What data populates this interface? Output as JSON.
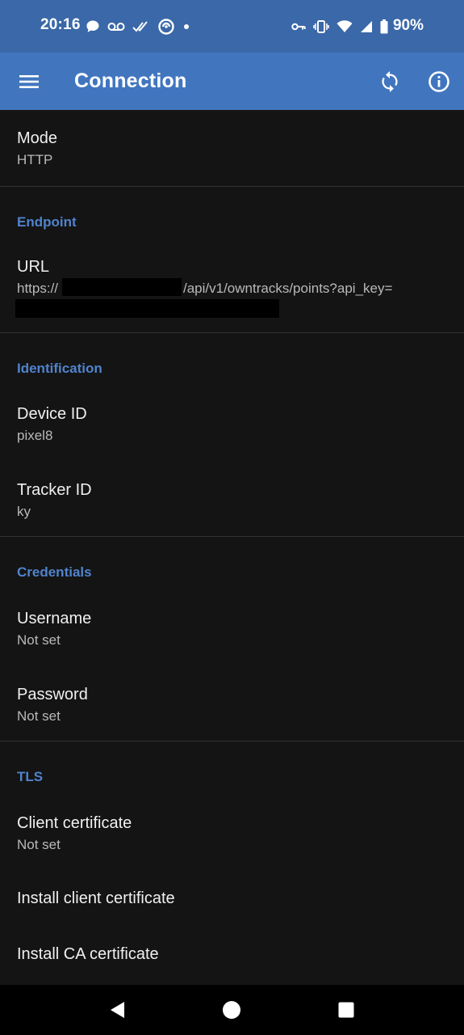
{
  "status_bar": {
    "time": "20:16",
    "battery": "90%"
  },
  "app_bar": {
    "title": "Connection",
    "icons": [
      "menu-icon",
      "sync-icon",
      "info-icon"
    ]
  },
  "preferences": {
    "mode": {
      "title": "Mode",
      "value": "HTTP"
    },
    "endpoint": {
      "category": "Endpoint",
      "url": {
        "title": "URL",
        "prefix": "https://",
        "suffix": "/api/v1/owntracks/points?api_key="
      }
    },
    "identification": {
      "category": "Identification",
      "device_id": {
        "title": "Device ID",
        "value": "pixel8"
      },
      "tracker_id": {
        "title": "Tracker ID",
        "value": "ky"
      }
    },
    "credentials": {
      "category": "Credentials",
      "username": {
        "title": "Username",
        "value": "Not set"
      },
      "password": {
        "title": "Password",
        "value": "Not set"
      }
    },
    "tls": {
      "category": "TLS",
      "client_certificate": {
        "title": "Client certificate",
        "value": "Not set"
      },
      "install_client_certificate": {
        "title": "Install client certificate"
      },
      "install_ca_certificate": {
        "title": "Install CA certificate"
      }
    }
  },
  "colors": {
    "status_bar": "#3a68a8",
    "app_bar": "#4176bf",
    "background": "#141414",
    "category_accent": "#5083cc"
  }
}
